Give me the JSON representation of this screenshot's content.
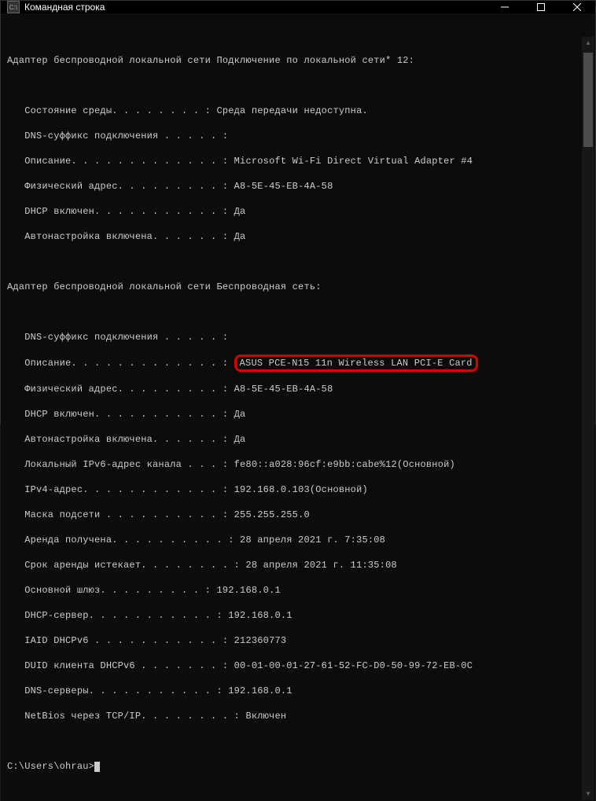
{
  "window": {
    "title": "Командная строка",
    "icon_label": "C:\\"
  },
  "adapter1": {
    "header": "Адаптер беспроводной локальной сети Подключение по локальной сети* 12:",
    "state_label": "   Состояние среды. . . . . . . . : ",
    "state_value": "Среда передачи недоступна.",
    "dns_suffix_label": "   DNS-суффикс подключения . . . . . :",
    "desc_label": "   Описание. . . . . . . . . . . . . : ",
    "desc_value": "Microsoft Wi-Fi Direct Virtual Adapter #4",
    "mac_label": "   Физический адрес. . . . . . . . . : ",
    "mac_value": "A8-5E-45-EB-4A-58",
    "dhcp_label": "   DHCP включен. . . . . . . . . . . : ",
    "dhcp_value": "Да",
    "auto_label": "   Автонастройка включена. . . . . . : ",
    "auto_value": "Да"
  },
  "adapter2": {
    "header": "Адаптер беспроводной локальной сети Беспроводная сеть:",
    "dns_suffix_label": "   DNS-суффикс подключения . . . . . :",
    "desc_label": "   Описание. . . . . . . . . . . . . : ",
    "desc_value": "ASUS PCE-N15 11n Wireless LAN PCI-E Card",
    "mac_label": "   Физический адрес. . . . . . . . . : ",
    "mac_value": "A8-5E-45-EB-4A-58",
    "dhcp_label": "   DHCP включен. . . . . . . . . . . : ",
    "dhcp_value": "Да",
    "auto_label": "   Автонастройка включена. . . . . . : ",
    "auto_value": "Да",
    "ipv6_label": "   Локальный IPv6-адрес канала . . . : ",
    "ipv6_value": "fe80::a028:96cf:e9bb:cabe%12(Основной)",
    "ipv4_label": "   IPv4-адрес. . . . . . . . . . . . : ",
    "ipv4_value": "192.168.0.103(Основной)",
    "mask_label": "   Маска подсети . . . . . . . . . . : ",
    "mask_value": "255.255.255.0",
    "lease_obtained_label": "   Аренда получена. . . . . . . . . . : ",
    "lease_obtained_value": "28 апреля 2021 г. 7:35:08",
    "lease_expires_label": "   Срок аренды истекает. . . . . . . . : ",
    "lease_expires_value": "28 апреля 2021 г. 11:35:08",
    "gateway_label": "   Основной шлюз. . . . . . . . . : ",
    "gateway_value": "192.168.0.1",
    "dhcp_server_label": "   DHCP-сервер. . . . . . . . . . . : ",
    "dhcp_server_value": "192.168.0.1",
    "iaid_label": "   IAID DHCPv6 . . . . . . . . . . . : ",
    "iaid_value": "212360773",
    "duid_label": "   DUID клиента DHCPv6 . . . . . . . : ",
    "duid_value": "00-01-00-01-27-61-52-FC-D0-50-99-72-EB-0C",
    "dns_servers_label": "   DNS-серверы. . . . . . . . . . . : ",
    "dns_servers_value": "192.168.0.1",
    "netbios_label": "   NetBios через TCP/IP. . . . . . . . : ",
    "netbios_value": "Включен"
  },
  "prompt": "C:\\Users\\ohrau>"
}
